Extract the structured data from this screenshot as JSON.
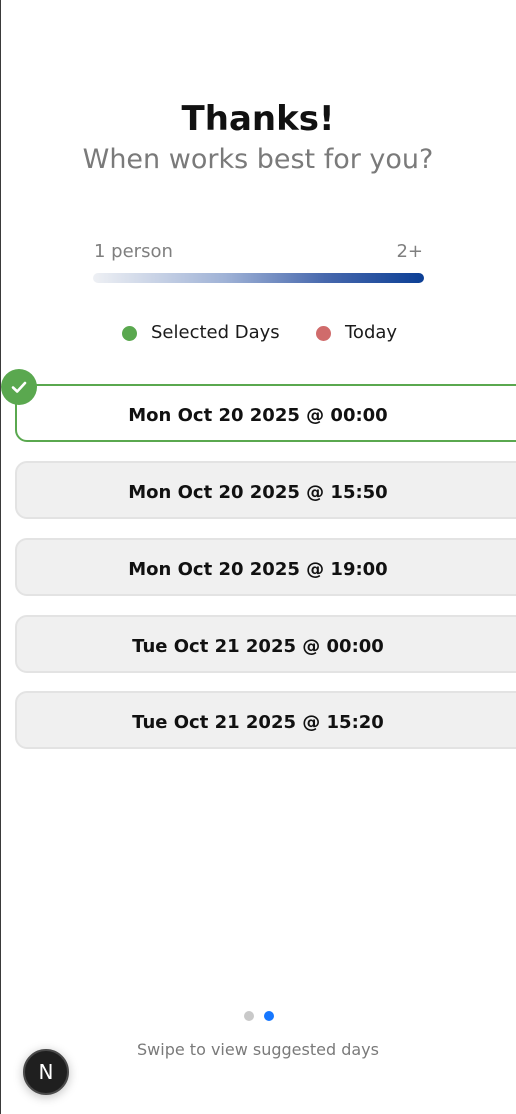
{
  "header": {
    "title": "Thanks!",
    "subtitle": "When works best for you?"
  },
  "availability_scale": {
    "min_label": "1 person",
    "max_label": "2+",
    "gradient_colors": [
      "#eef0f4",
      "#0c3f95"
    ]
  },
  "legend": {
    "items": [
      {
        "label": "Selected Days",
        "color": "#5aa84f"
      },
      {
        "label": "Today",
        "color": "#d06b6b"
      }
    ]
  },
  "time_slots": [
    {
      "label": "Mon Oct 20 2025 @ 00:00",
      "selected": true
    },
    {
      "label": "Mon Oct 20 2025 @ 15:50",
      "selected": false
    },
    {
      "label": "Mon Oct 20 2025 @ 19:00",
      "selected": false
    },
    {
      "label": "Tue Oct 21 2025 @ 00:00",
      "selected": false
    },
    {
      "label": "Tue Oct 21 2025 @ 15:20",
      "selected": false
    }
  ],
  "pager": {
    "page_count": 2,
    "active_page": 2
  },
  "footer": {
    "hint": "Swipe to view suggested days"
  },
  "dev_badge": {
    "letter": "N"
  },
  "colors": {
    "selected_accent": "#5aa84f",
    "today": "#d06b6b",
    "pager_active": "#1677ff",
    "pager_inactive": "#c9c9c9"
  }
}
